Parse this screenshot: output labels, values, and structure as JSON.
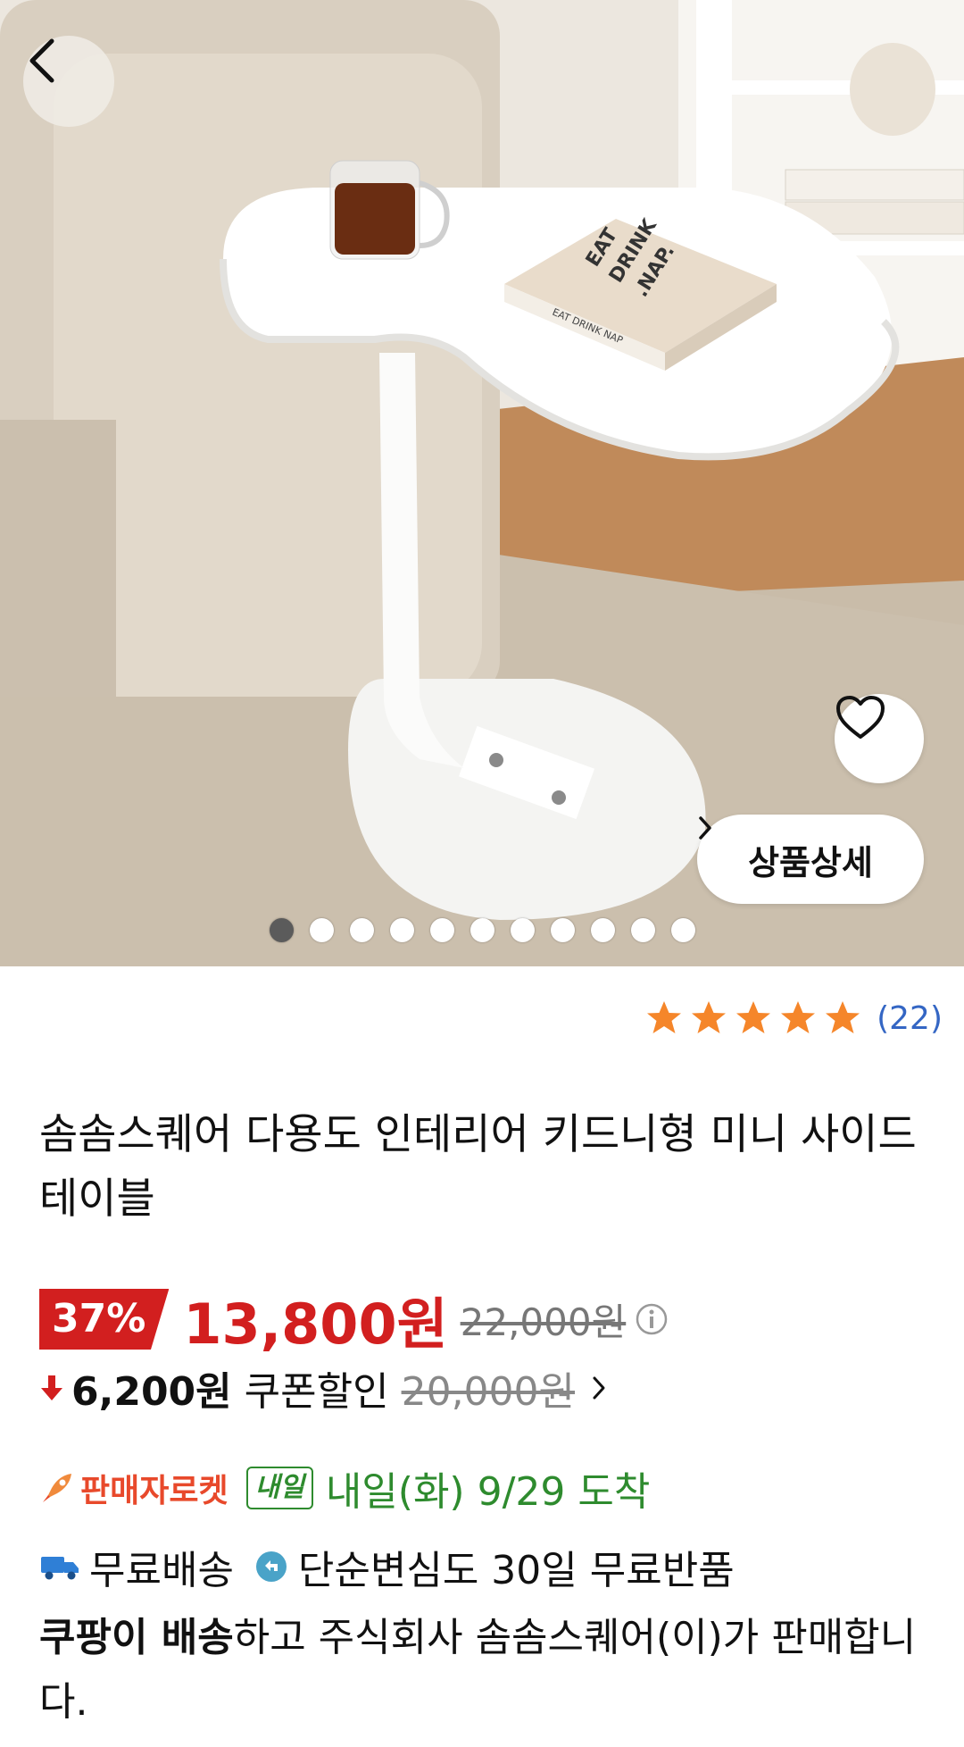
{
  "gallery": {
    "image_count": 11,
    "active_index": 0,
    "detail_button_label": "상품상세",
    "book_title_line1": "EAT",
    "book_title_line2": "DRINK",
    "book_title_line3": ".NAP.",
    "book_spine": "EAT DRINK NAP"
  },
  "rating": {
    "stars": 5,
    "count": "(22)"
  },
  "product": {
    "title": "솜솜스퀘어 다용도 인테리어 키드니형 미니 사이드 테이블"
  },
  "price": {
    "discount": "37%",
    "sale": "13,800원",
    "original": "22,000원"
  },
  "coupon": {
    "amount": "6,200원",
    "label": "쿠폰할인",
    "original": "20,000원"
  },
  "delivery": {
    "badge": "판매자로켓",
    "tomorrow_badge": "내일",
    "arrival": "내일(화) 9/29 도착",
    "free_shipping": "무료배송",
    "returns": "단순변심도 30일 무료반품"
  },
  "seller": {
    "bold": "쿠팡이 배송",
    "rest": "하고 주식회사 솜솜스퀘어(이)가 판매합니다."
  },
  "colors": {
    "discount_red": "#d21f1f",
    "link_blue": "#3466c4",
    "delivery_green": "#2e8b2e",
    "star_orange": "#f5862a"
  }
}
